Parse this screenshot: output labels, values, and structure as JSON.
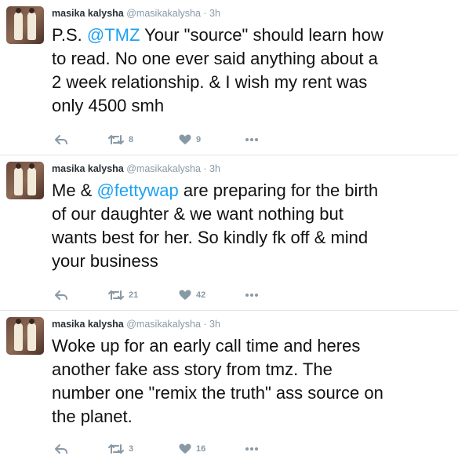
{
  "tweets": [
    {
      "name": "masika kalysha",
      "handle": "@masikakalysha",
      "separator": "·",
      "time": "3h",
      "text_before": "P.S. ",
      "mention": "@TMZ",
      "text_after": " Your \"source\" should learn how\nto read. No one ever said anything about a\n2 week relationship. & I wish my rent was\nonly 4500 smh",
      "retweets": "8",
      "likes": "9"
    },
    {
      "name": "masika kalysha",
      "handle": "@masikakalysha",
      "separator": "·",
      "time": "3h",
      "text_before": "Me & ",
      "mention": "@fettywap",
      "text_after": " are preparing for the birth\nof our daughter & we want nothing but\nwants best for her. So kindly fk off & mind\nyour business",
      "retweets": "21",
      "likes": "42"
    },
    {
      "name": "masika kalysha",
      "handle": "@masikakalysha",
      "separator": "·",
      "time": "3h",
      "text_before": "Woke up for an early call time and heres\nanother fake ass story from tmz. The\nnumber one \"remix the truth\" ass source on\nthe planet.",
      "mention": "",
      "text_after": "",
      "retweets": "3",
      "likes": "16"
    }
  ],
  "colors": {
    "mention": "#1da1f2",
    "meta": "#8899a6",
    "border": "#e1e8ed"
  },
  "icons": [
    "reply-icon",
    "retweet-icon",
    "heart-icon",
    "more-icon"
  ]
}
